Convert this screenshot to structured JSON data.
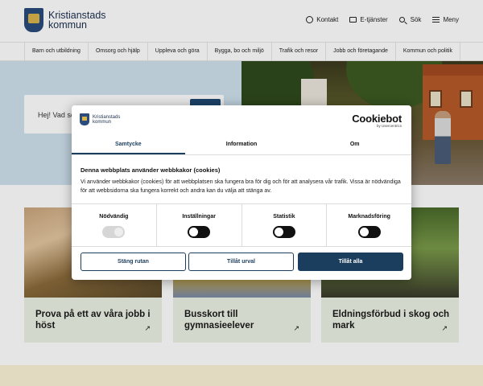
{
  "header": {
    "logo_line1": "Kristianstads",
    "logo_line2": "kommun",
    "links": [
      {
        "label": "Kontakt",
        "icon": "chat-icon"
      },
      {
        "label": "E-tjänster",
        "icon": "monitor-icon"
      },
      {
        "label": "Sök",
        "icon": "search-icon"
      },
      {
        "label": "Meny",
        "icon": "menu-icon"
      }
    ]
  },
  "nav": {
    "items": [
      "Barn och utbildning",
      "Omsorg och hjälp",
      "Uppleva och göra",
      "Bygga, bo och miljö",
      "Trafik och resor",
      "Jobb och företagande",
      "Kommun och politik"
    ]
  },
  "hero": {
    "search_text": "Hej! Vad sö"
  },
  "cards": [
    {
      "title": "Prova på ett av våra jobb i höst",
      "arrow": "↗"
    },
    {
      "title": "Busskort till gymnasieelever",
      "arrow": "↗"
    },
    {
      "title": "Eldningsförbud i skog och mark",
      "arrow": "↗"
    }
  ],
  "cookie_dialog": {
    "logo_line1": "Kristianstads",
    "logo_line2": "kommun",
    "brand": "Cookiebot",
    "brand_sub": "by Usercentrics",
    "tabs": [
      "Samtycke",
      "Information",
      "Om"
    ],
    "active_tab": "Samtycke",
    "heading": "Denna webbplats använder webbkakor (cookies)",
    "body": "Vi använder webbkakor (cookies) för att webbplatsen ska fungera bra för dig och för att analysera vår trafik. Vissa är nödvändiga för att webbsidorna ska fungera korrekt och andra kan du välja att stänga av.",
    "toggles": [
      {
        "label": "Nödvändig",
        "state": "on",
        "disabled": true
      },
      {
        "label": "Inställningar",
        "state": "off",
        "disabled": false
      },
      {
        "label": "Statistik",
        "state": "off",
        "disabled": false
      },
      {
        "label": "Marknadsföring",
        "state": "off",
        "disabled": false
      }
    ],
    "buttons": {
      "close": "Stäng rutan",
      "allow_selection": "Tillåt urval",
      "allow_all": "Tillåt alla"
    }
  },
  "colors": {
    "brand_navy": "#1c3e5e",
    "hero_blue": "#cfe1ee",
    "card_green": "#ebf1e4",
    "strip_yellow": "#fbf3d6"
  }
}
